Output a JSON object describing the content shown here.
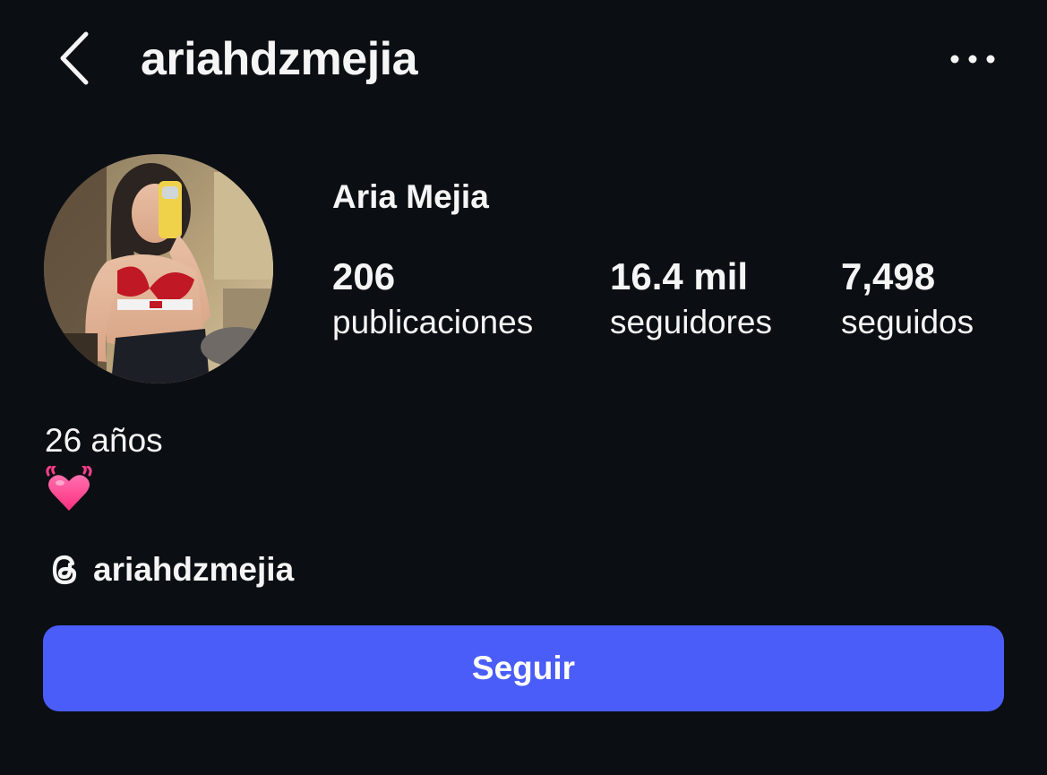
{
  "header": {
    "username": "ariahdzmejia",
    "back_icon": "chevron-left-icon",
    "more_icon": "more-horizontal-icon"
  },
  "profile": {
    "display_name": "Aria Mejia",
    "stats": {
      "posts": {
        "value": "206",
        "label": "publicaciones"
      },
      "followers": {
        "value": "16.4 mil",
        "label": "seguidores"
      },
      "following": {
        "value": "7,498",
        "label": "seguidos"
      }
    },
    "bio": {
      "line1": "26 años",
      "emoji": "beating-heart-icon"
    },
    "threads": {
      "icon": "threads-icon",
      "handle": "ariahdzmejia"
    }
  },
  "actions": {
    "follow_label": "Seguir"
  },
  "colors": {
    "background": "#0b0f14",
    "text": "#f5f5f5",
    "accent": "#4a5df9",
    "heart": "#ff3d8b"
  }
}
